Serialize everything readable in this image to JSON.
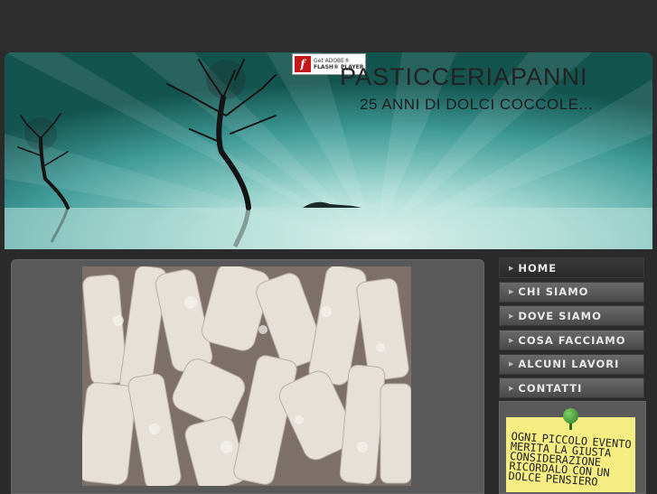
{
  "header": {
    "title": "PASTICCERIAPANNI",
    "tagline": "25 ANNI DI DOLCI COCCOLE...",
    "flash_badge": {
      "line1": "Get ADOBE®",
      "line2": "FLASH® PLAYER",
      "icon": "flash-icon"
    }
  },
  "nav": {
    "items": [
      {
        "label": "HOME",
        "active": true
      },
      {
        "label": "CHI SIAMO",
        "active": false
      },
      {
        "label": "DOVE SIAMO",
        "active": false
      },
      {
        "label": "COSA FACCIAMO",
        "active": false
      },
      {
        "label": "ALCUNI LAVORI",
        "active": false
      },
      {
        "label": "CONTATTI",
        "active": false
      }
    ]
  },
  "sidebar": {
    "note_text": "OGNI PICCOLO EVENTO MERITA LA GIUSTA CONSIDERAZIONE RICORDALO CON UN DOLCE PENSIERO"
  },
  "colors": {
    "background": "#2b2b2b",
    "banner_light": "#dff4ef",
    "banner_dark": "#17625f",
    "note": "#f5ec82",
    "pin": "#4da33a"
  }
}
